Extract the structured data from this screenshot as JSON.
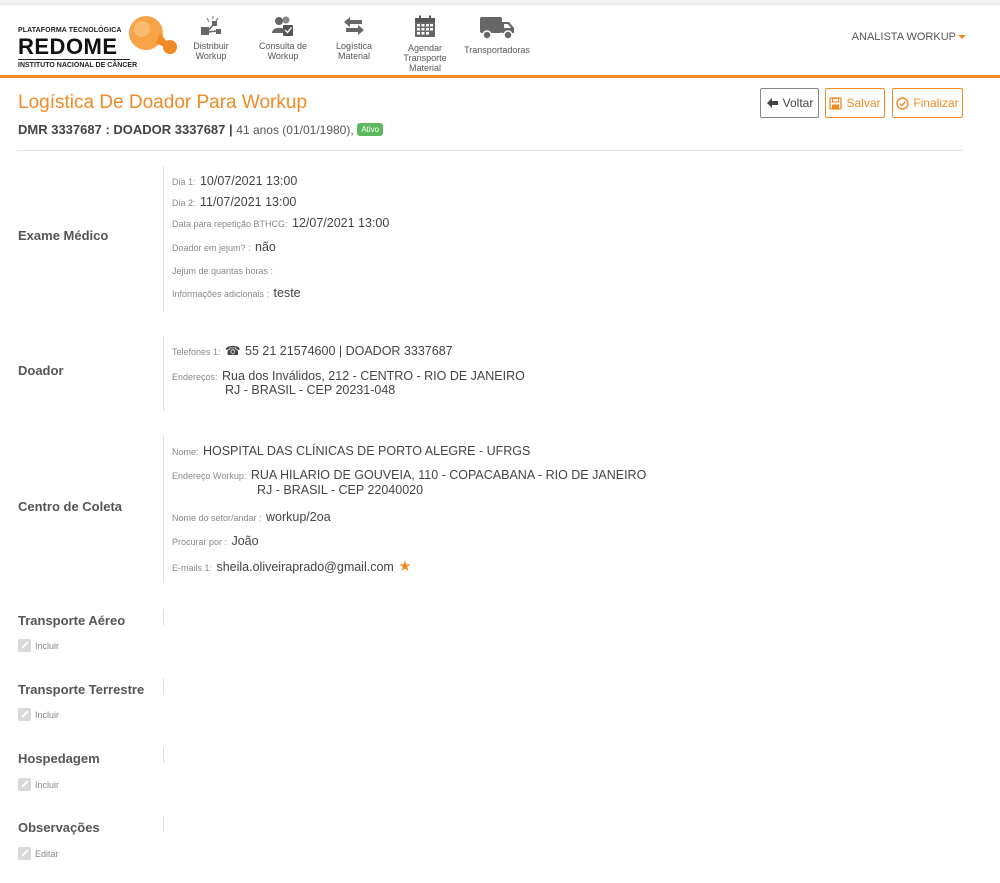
{
  "brand": {
    "line1": "PLATAFORMA TECNOLÓGICA",
    "name": "REDOME",
    "line3": "INSTITUTO NACIONAL DE CÂNCER",
    "accent_color": "#f08a24"
  },
  "nav": {
    "items": [
      {
        "label": "Distribuir Workup",
        "icon": "distribute-icon"
      },
      {
        "label": "Consulta de Workup",
        "icon": "consult-icon"
      },
      {
        "label": "Logística Material",
        "icon": "arrows-exchange-icon"
      },
      {
        "label": "Agendar Transporte Material",
        "icon": "calendar-icon"
      },
      {
        "label": "Transportadoras",
        "icon": "truck-icon"
      }
    ],
    "user": "ANALISTA WORKUP"
  },
  "page": {
    "title": "Logística De Doador Para Workup",
    "dmr": "DMR 3337687 : DOADOR 3337687 |",
    "age": "41 anos (01/01/1980),",
    "status": "Ativo"
  },
  "buttons": {
    "voltar": "Voltar",
    "salvar": "Salvar",
    "finalizar": "Finalizar"
  },
  "exame": {
    "label": "Exame Médico",
    "dia1_label": "Dia 1:",
    "dia1": "10/07/2021 13:00",
    "dia2_label": "Dia 2:",
    "dia2": "11/07/2021 13:00",
    "rep_label": "Data para repetição BTHCG:",
    "rep": "12/07/2021 13:00",
    "jejum_label": "Doador em jejum? :",
    "jejum": "não",
    "horas_label": "Jejum de quantas horas :",
    "horas": "",
    "info_label": "Informações adicionais :",
    "info": "teste"
  },
  "doador": {
    "label": "Doador",
    "tel_label": "Telefones 1:",
    "tel": "55 21 21574600 | DOADOR 3337687",
    "end_label": "Endereços:",
    "end1": "Rua dos Inválidos, 212 - CENTRO - RIO DE JANEIRO",
    "end2": "RJ - BRASIL - CEP 20231-048"
  },
  "centro": {
    "label": "Centro de Coleta",
    "nome_label": "Nome:",
    "nome": "HOSPITAL DAS CLÍNICAS DE PORTO ALEGRE - UFRGS",
    "end_label": "Endereço Workup:",
    "end1": "RUA HILARIO DE GOUVEIA, 110 - COPACABANA - RIO DE JANEIRO",
    "end2": "RJ - BRASIL - CEP 22040020",
    "setor_label": "Nome do setor/andar :",
    "setor": "workup/2oa",
    "procurar_label": "Procurar por :",
    "procurar": "João",
    "email_label": "E-mails 1:",
    "email": "sheila.oliveiraprado@gmail.com"
  },
  "sections": [
    {
      "label": "Transporte Aéreo",
      "action": "Incluir"
    },
    {
      "label": "Transporte Terrestre",
      "action": "Incluir"
    },
    {
      "label": "Hospedagem",
      "action": "Incluir"
    },
    {
      "label": "Observações",
      "action": "Editar"
    }
  ]
}
